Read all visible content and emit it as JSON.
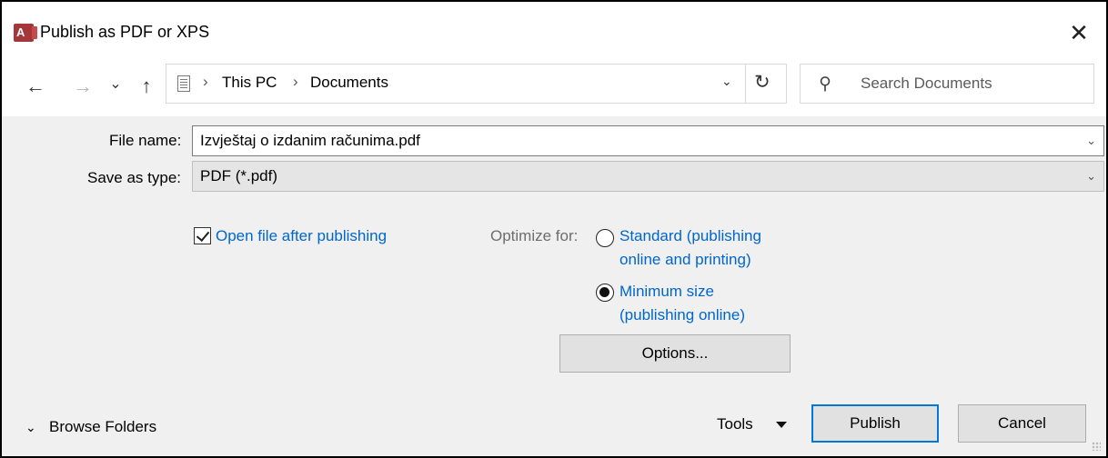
{
  "window": {
    "title": "Publish as PDF or XPS",
    "app_badge": "A"
  },
  "nav": {
    "back_glyph": "←",
    "forward_glyph": "→",
    "recent_glyph": "⌄",
    "up_glyph": "↑",
    "breadcrumb": [
      "This PC",
      "Documents"
    ],
    "separator": "›",
    "dropdown_glyph": "⌄",
    "refresh_glyph": "↻",
    "search_placeholder": "Search Documents"
  },
  "form": {
    "file_name_label": "File name:",
    "file_name_value": "Izvještaj o izdanim računima.pdf",
    "type_label": "Save as type:",
    "type_value": "PDF (*.pdf)",
    "dropdown_glyph": "⌄"
  },
  "options": {
    "open_after_label": "Open file after publishing",
    "open_after_checked": true,
    "optimize_label": "Optimize for:",
    "standard_line1": "Standard (publishing",
    "standard_line2": "online and printing)",
    "standard_selected": false,
    "minimum_line1": "Minimum size",
    "minimum_line2": "(publishing online)",
    "minimum_selected": true,
    "options_button": "Options..."
  },
  "footer": {
    "browse_chevron": "⌄",
    "browse_label": "Browse Folders",
    "tools_label": "Tools",
    "publish_button": "Publish",
    "cancel_button": "Cancel"
  },
  "colors": {
    "accent": "#0078d7",
    "link": "#0066cc",
    "app_icon": "#a4373a"
  }
}
